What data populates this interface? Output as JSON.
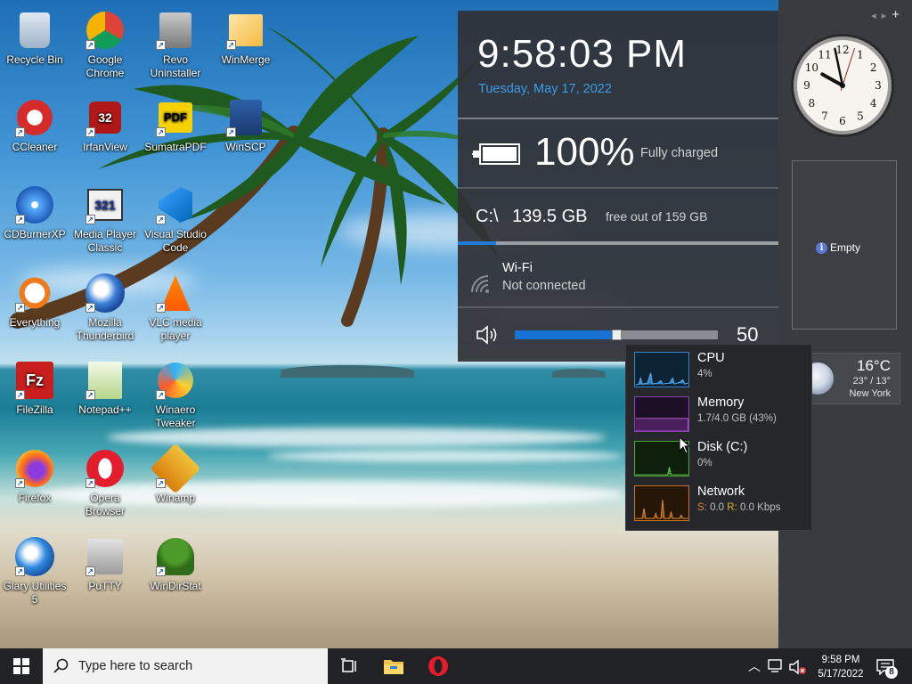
{
  "desktop": {
    "icons": [
      {
        "id": "recycle-bin",
        "label": "Recycle Bin",
        "icon": "recycle-bin-icon",
        "shortcut": false
      },
      {
        "id": "google-chrome",
        "label": "Google Chrome",
        "icon": "chrome-icon",
        "shortcut": true
      },
      {
        "id": "revo-uninstaller",
        "label": "Revo Uninstaller",
        "icon": "revo-uninstaller-icon",
        "shortcut": true
      },
      {
        "id": "winmerge",
        "label": "WinMerge",
        "icon": "winmerge-icon",
        "shortcut": true
      },
      {
        "id": "ccleaner",
        "label": "CCleaner",
        "icon": "ccleaner-icon",
        "shortcut": true
      },
      {
        "id": "irfanview",
        "label": "IrfanView",
        "icon": "irfanview-icon",
        "shortcut": true,
        "badge": "32"
      },
      {
        "id": "sumatrapdf",
        "label": "SumatraPDF",
        "icon": "sumatrapdf-icon",
        "shortcut": true,
        "badge": "PDF"
      },
      {
        "id": "winscp",
        "label": "WinSCP",
        "icon": "winscp-icon",
        "shortcut": true
      },
      {
        "id": "cdburnerxp",
        "label": "CDBurnerXP",
        "icon": "cdburnerxp-icon",
        "shortcut": true
      },
      {
        "id": "media-player-classic",
        "label": "Media Player Classic",
        "icon": "media-player-classic-icon",
        "shortcut": true,
        "badge": "321"
      },
      {
        "id": "visual-studio-code",
        "label": "Visual Studio Code",
        "icon": "vscode-icon",
        "shortcut": true
      },
      {
        "id": "everything",
        "label": "Everything",
        "icon": "everything-search-icon",
        "shortcut": true
      },
      {
        "id": "mozilla-thunderbird",
        "label": "Mozilla Thunderbird",
        "icon": "thunderbird-icon",
        "shortcut": true
      },
      {
        "id": "vlc-media-player",
        "label": "VLC media player",
        "icon": "vlc-icon",
        "shortcut": true
      },
      {
        "id": "filezilla",
        "label": "FileZilla",
        "icon": "filezilla-icon",
        "shortcut": true,
        "badge": "Fz"
      },
      {
        "id": "notepad-plus-plus",
        "label": "Notepad++",
        "icon": "notepad-plus-plus-icon",
        "shortcut": true
      },
      {
        "id": "winaero-tweaker",
        "label": "Winaero Tweaker",
        "icon": "winaero-tweaker-icon",
        "shortcut": true
      },
      {
        "id": "firefox",
        "label": "Firefox",
        "icon": "firefox-icon",
        "shortcut": true
      },
      {
        "id": "opera-browser",
        "label": "Opera Browser",
        "icon": "opera-icon",
        "shortcut": true
      },
      {
        "id": "winamp",
        "label": "Winamp",
        "icon": "winamp-icon",
        "shortcut": true
      },
      {
        "id": "glary-utilities",
        "label": "Glary Utilities 5",
        "icon": "glary-utilities-icon",
        "shortcut": true
      },
      {
        "id": "putty",
        "label": "PuTTY",
        "icon": "putty-icon",
        "shortcut": true
      },
      {
        "id": "windirstat",
        "label": "WinDirStat",
        "icon": "windirstat-icon",
        "shortcut": true
      }
    ]
  },
  "info_panel": {
    "time": "9:58:03 PM",
    "date": "Tuesday, May 17, 2022",
    "battery": {
      "percent_text": "100%",
      "status": "Fully charged",
      "level": 1.0
    },
    "disk": {
      "drive": "C:\\",
      "free": "139.5 GB",
      "description": "free out of 159 GB",
      "used_fraction": 0.12
    },
    "wifi": {
      "title": "Wi-Fi",
      "status": "Not connected"
    },
    "volume": {
      "value": "50",
      "level": 0.5
    }
  },
  "gadgets": {
    "clock": {
      "hour": 9,
      "minute": 58,
      "second": 3
    },
    "empty": {
      "label": "Empty"
    },
    "weather": {
      "temp": "16°C",
      "range": "23° / 13°",
      "city": "New York"
    }
  },
  "perf": {
    "items": [
      {
        "name": "CPU",
        "value": "4%",
        "color": "#2f86c8"
      },
      {
        "name": "Memory",
        "value": "1.7/4.0 GB (43%)",
        "color": "#8a3db0"
      },
      {
        "name": "Disk (C:)",
        "value": "0%",
        "color": "#4da637"
      },
      {
        "name": "Network",
        "value_s_label": "S:",
        "value_s": "0.0",
        "value_r_label": "R:",
        "value_r": "0.0 Kbps",
        "color": "#c8701c"
      }
    ]
  },
  "taskbar": {
    "search_placeholder": "Type here to search",
    "clock_time": "9:58 PM",
    "clock_date": "5/17/2022",
    "notification_count": "8"
  },
  "colors": {
    "accent": "#1f7ad8",
    "date": "#3d9be8",
    "network_send": "#e08a2a",
    "network_recv": "#e0b02a"
  }
}
